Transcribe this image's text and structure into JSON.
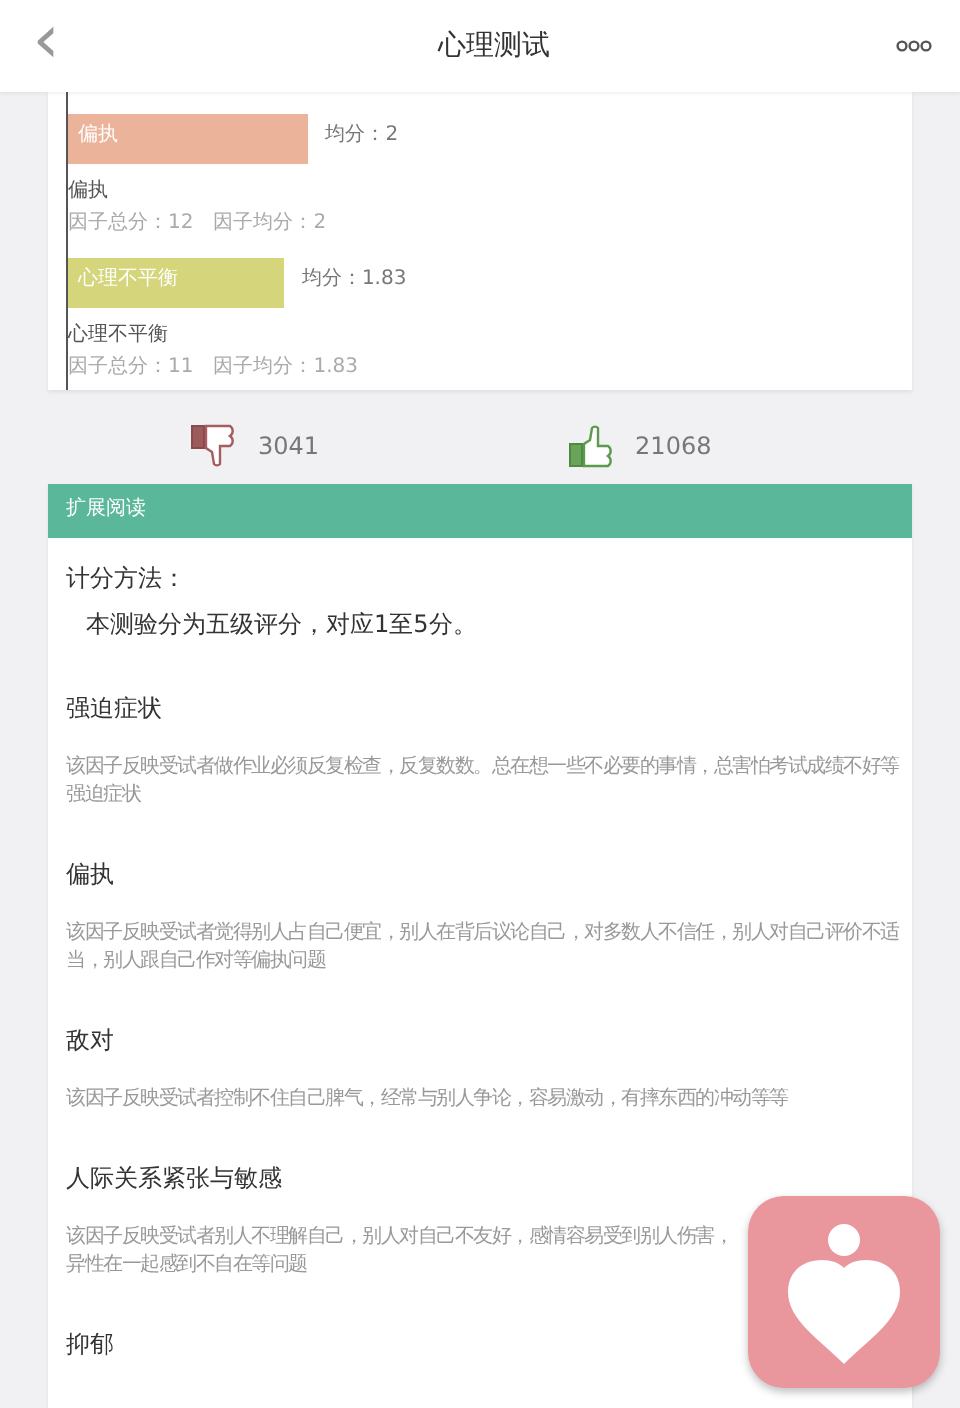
{
  "header": {
    "back_icon": "‹",
    "title": "心理测试"
  },
  "factors": [
    {
      "bar_label": "偏执",
      "average": "均分：2",
      "name": "偏执",
      "total_score": "因子总分：12",
      "factor_average": "因子均分：2",
      "level": 0.285,
      "color": "#eab39a"
    },
    {
      "bar_label": "心理不平衡",
      "average": "均分：1.83",
      "name": "心理不平衡",
      "total_score": "因子总分：11",
      "factor_average": "因子均分：1.83",
      "level": 0.257,
      "color": "#d5d57c"
    }
  ],
  "votes": {
    "dislikes": "3041",
    "likes": "21068"
  },
  "reading": {
    "title": "扩展阅读",
    "method_label": "计分方法：",
    "method_text": "本测验分为五级评分，对应1至5分。",
    "sections": [
      {
        "heading": "强迫症状",
        "lines": [
          "该因子反映受试者做作业必须反复检查，反复数数。总在想一些不必要的事情，总害怕考试成绩不好等",
          "强迫症状"
        ]
      },
      {
        "heading": "偏执",
        "lines": [
          "该因子反映受试者觉得别人占自己便宜，别人在背后议论自己，对多数人不信任，别人对自己评价不适",
          "当，别人跟自己作对等偏执问题"
        ]
      },
      {
        "heading": "敌对",
        "lines": [
          "该因子反映受试者控制不住自己脾气，经常与别人争论，容易激动，有摔东西的冲动等等"
        ]
      },
      {
        "heading": "人际关系紧张与敏感",
        "lines": [
          "该因子反映受试者别人不理解自己，别人对自己不友好，感情容易受到别人伤害，",
          "异性在一起感到不自在等问题"
        ]
      },
      {
        "heading": "抑郁"
      }
    ]
  }
}
